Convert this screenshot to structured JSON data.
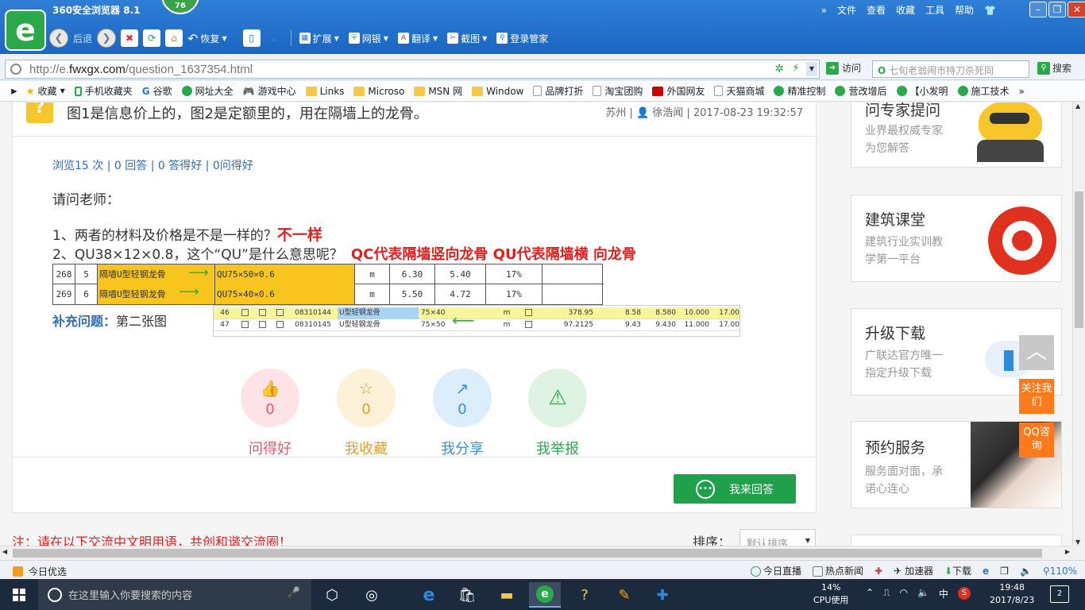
{
  "browser": {
    "title": "360安全浏览器 8.1",
    "badge": "76",
    "menu": [
      "文件",
      "查看",
      "收藏",
      "工具",
      "帮助"
    ],
    "toolbar": {
      "back": "后退",
      "restore": "恢复",
      "extend": "扩展",
      "netbank": "网银",
      "translate": "翻译",
      "screenshot": "截图",
      "login": "登录管家"
    },
    "url_prefix": "http://e.",
    "url_domain": "fwxgx.com",
    "url_path": "/question_1637354.html",
    "visit": "访问",
    "search_placeholder": "七旬老翁闹市持刀杀死同",
    "search_btn": "搜索"
  },
  "bookmarks": [
    "收藏",
    "手机收藏夹",
    "谷歌",
    "网址大全",
    "游戏中心",
    "Links",
    "Microso",
    "MSN 网",
    "Window",
    "品牌打折",
    "淘宝团购",
    "外国网友",
    "天猫商城",
    "精准控制",
    "营改增后",
    "【小发明",
    "施工技术"
  ],
  "question": {
    "title": "图1是信息价上的，图2是定额里的，用在隔墙上的龙骨。",
    "meta": "苏州 | 👤 徐浩闻 | 2017-08-23 19:32:57",
    "stats": "浏览15 次 | 0 回答 | 0 答得好 | 0问得好",
    "greeting": "请问老师：",
    "q1": "1、两者的材料及价格是不是一样的？",
    "q1_answer": "不一样",
    "q2": "2、QU38×12×0.8，这个“QU”是什么意思呢？",
    "q2_answer": "QC代表隔墙竖向龙骨  QU代表隔墙横 向龙骨",
    "supp_label": "补充问题：",
    "supp_text": "第二张图"
  },
  "table1": {
    "rows": [
      {
        "no": "268",
        "idx": "5",
        "name": "隔墙U型轻钢龙骨",
        "spec": "QU75×50×0.6",
        "unit": "m",
        "p1": "6.30",
        "p2": "5.40",
        "rate": "17%"
      },
      {
        "no": "269",
        "idx": "6",
        "name": "隔墙U型轻钢龙骨",
        "spec": "QU75×40×0.6",
        "unit": "m",
        "p1": "5.50",
        "p2": "4.72",
        "rate": "17%"
      }
    ]
  },
  "table2": {
    "rows": [
      {
        "no": "46",
        "code": "08310144",
        "name": "U型轻钢龙骨",
        "spec": "75×40",
        "unit": "m",
        "v1": "378.95",
        "v2": "8.58",
        "v3": "8.580",
        "v4": "10.000",
        "v5": "17.00"
      },
      {
        "no": "47",
        "code": "08310145",
        "name": "U型轻钢龙骨",
        "spec": "75×50",
        "unit": "m",
        "v1": "97.2125",
        "v2": "9.43",
        "v3": "9.430",
        "v4": "11.000",
        "v5": "17.00"
      }
    ]
  },
  "actions": [
    {
      "label": "问得好",
      "count": "0",
      "color": "#e5576b",
      "bg": "#fde3e6"
    },
    {
      "label": "我收藏",
      "count": "0",
      "color": "#e0a030",
      "bg": "#fdf1d8"
    },
    {
      "label": "我分享",
      "count": "0",
      "color": "#3a8fd8",
      "bg": "#dcedfb"
    },
    {
      "label": "我举报",
      "count": "",
      "color": "#2aa84a",
      "bg": "#dff3e3"
    }
  ],
  "answer_btn": "我来回答",
  "notice": "注：请在以下交流中文明用语，共创和谐交流圈！",
  "sort": {
    "label": "排序：",
    "value": "默认排序"
  },
  "sidebar": [
    {
      "title": "问专家提问",
      "desc1": "业界最权威专家",
      "desc2": "为您解答"
    },
    {
      "title": "建筑课堂",
      "desc1": "建筑行业实训教",
      "desc2": "学第一平台"
    },
    {
      "title": "升级下载",
      "desc1": "广联达官方唯一",
      "desc2": "指定升级下载"
    },
    {
      "title": "预约服务",
      "desc1": "服务面对面，承",
      "desc2": "诺心连心"
    }
  ],
  "float": {
    "follow": "关注我们",
    "qq": "QQ咨询"
  },
  "status": {
    "left": "今日优选",
    "live": "今日直播",
    "news": "热点新闻",
    "accel": "加速器",
    "download": "下载",
    "zoom": "110%"
  },
  "taskbar": {
    "search_placeholder": "在这里输入你要搜索的内容",
    "cpu_pct": "14%",
    "cpu_label": "CPU使用",
    "ime": "中",
    "time": "19:48",
    "date": "2017/8/23",
    "notif": "2"
  }
}
